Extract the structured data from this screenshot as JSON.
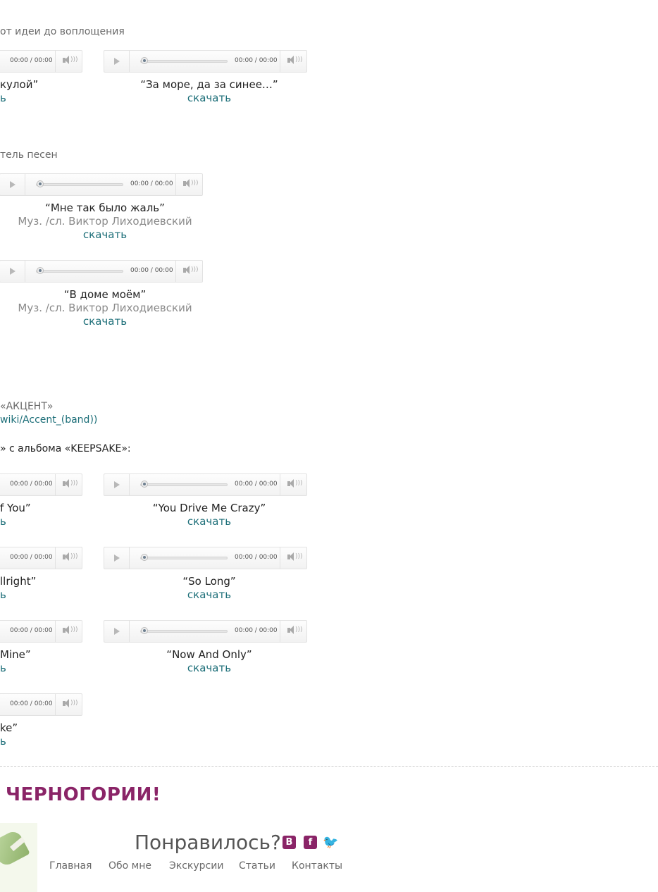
{
  "section1": {
    "heading": "от идеи до воплощения",
    "tracks": [
      {
        "title": "кулой”",
        "download": "ь"
      },
      {
        "title": "“За море, да за синее…”",
        "download": "скачать"
      }
    ]
  },
  "section2": {
    "heading": "тель песен",
    "tracks": [
      {
        "title": "“Мне так было жаль”",
        "author": "Муз. /сл. Виктор Лиходиевский",
        "download": "скачать"
      },
      {
        "title": "“В доме моём”",
        "author": "Муз. /сл. Виктор Лиходиевский",
        "download": "скачать"
      }
    ]
  },
  "section3": {
    "band": "«АКЦЕНТ»",
    "link": "wiki/Accent_(band))",
    "album_line": "» с альбома «KEEPSAKE»:",
    "tracks": [
      {
        "title": "f You”",
        "download": "ь"
      },
      {
        "title": "“You Drive Me Crazy”",
        "download": "скачать"
      },
      {
        "title": "llright”",
        "download": "ь"
      },
      {
        "title": "“So Long”",
        "download": "скачать"
      },
      {
        "title": "Mine”",
        "download": "ь"
      },
      {
        "title": "“Now And Only”",
        "download": "скачать"
      },
      {
        "title": "ke”",
        "download": "ь"
      }
    ]
  },
  "player": {
    "time": "00:00 / 00:00",
    "progress": 0
  },
  "footer": {
    "promo": "ЧЕРНОГОРИИ!",
    "like": "Понравилось?",
    "social": {
      "vk": "B",
      "fb": "f",
      "tw": "🐦"
    },
    "nav": [
      "Главная",
      "Обо мне",
      "Экскурсии",
      "Статьи",
      "Контакты"
    ]
  },
  "colors": {
    "accent": "#8a2467",
    "link": "#1c6e78"
  }
}
